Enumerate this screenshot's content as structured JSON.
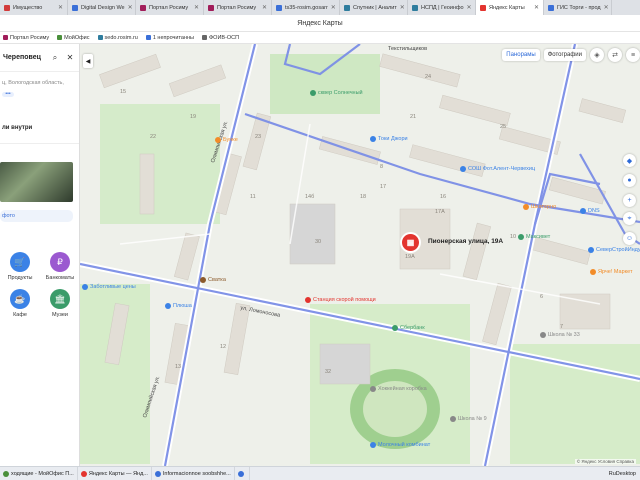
{
  "browser": {
    "tabs": [
      {
        "label": "Имущество",
        "color": "#d23b3b"
      },
      {
        "label": "Digital Design We",
        "color": "#3a6fd8"
      },
      {
        "label": "Портал Росиму",
        "color": "#a11d5a"
      },
      {
        "label": "Портал Росиму",
        "color": "#a11d5a"
      },
      {
        "label": "ts35-rosim.gosarr",
        "color": "#3a6fd8"
      },
      {
        "label": "Спутник | Аналит",
        "color": "#2f7d9e"
      },
      {
        "label": "НСПД | Геоинфо",
        "color": "#2f7d9e"
      },
      {
        "label": "Яндекс Карты",
        "color": "#e3342f"
      },
      {
        "label": "ГИС Торги - прод",
        "color": "#3a6fd8"
      }
    ],
    "window_title": "Яндекс Карты",
    "bookmarks": [
      {
        "label": "Портал Росиму",
        "color": "#a11d5a"
      },
      {
        "label": "МойОфис",
        "color": "#4a8f3a"
      },
      {
        "label": "sedo.rosim.ru",
        "color": "#2f7d9e"
      },
      {
        "label": "1 непрочитанны",
        "color": "#3a6fd8"
      },
      {
        "label": "ФОИВ-ОСП",
        "color": "#666666"
      }
    ]
  },
  "sidebar": {
    "search_value": "Череповец",
    "address": "ц, Вологодская область,",
    "more": "•••",
    "inside_label": "ли внутри",
    "photo_link": "фото",
    "categories": [
      {
        "label": "Продукты",
        "icon": "cart-icon",
        "color": "#3b82e6",
        "glyph": "🛒"
      },
      {
        "label": "Банкоматы",
        "icon": "ruble-icon",
        "color": "#9b59d0",
        "glyph": "₽"
      },
      {
        "label": "Кафе",
        "icon": "cup-icon",
        "color": "#3b82e6",
        "glyph": "☕"
      },
      {
        "label": "Музеи",
        "icon": "museum-icon",
        "color": "#3b9c6a",
        "glyph": "🏛"
      }
    ]
  },
  "map": {
    "buttons": {
      "panoramas": "Панорамы",
      "photos": "Фотографии"
    },
    "selected": {
      "label": "Пионерская улица, 19А"
    },
    "streets": [
      {
        "label": "Текстильщиков"
      },
      {
        "label": "Олимпийская ул."
      },
      {
        "label": "Пионерская ул."
      },
      {
        "label": "ул. Ломоносова"
      }
    ],
    "places": [
      {
        "label": "сквер Солнечный",
        "color": "#3b9c6a"
      },
      {
        "label": "Бунке",
        "color": "#f28c28"
      },
      {
        "label": "Токи Джори",
        "color": "#3b82e6"
      },
      {
        "label": "СОШ Фот.Алент-Червехиц",
        "color": "#3b82e6"
      },
      {
        "label": "Шкатерно",
        "color": "#f28c28"
      },
      {
        "label": "Максивет",
        "color": "#3b9c6a"
      },
      {
        "label": "DNS",
        "color": "#3b82e6"
      },
      {
        "label": "СеверСтройИндустрия",
        "color": "#3b82e6"
      },
      {
        "label": "Ярче! Маркет",
        "color": "#f28c28"
      },
      {
        "label": "Сватка",
        "color": "#8b5a2b"
      },
      {
        "label": "Станция скорой помощи",
        "color": "#e3342f"
      },
      {
        "label": "Сбербанк",
        "color": "#3b9c6a"
      },
      {
        "label": "Заботливые цены",
        "color": "#3b82e6"
      },
      {
        "label": "Плюша",
        "color": "#3b82e6"
      },
      {
        "label": "Школа № 33",
        "color": "#888888"
      },
      {
        "label": "Школа № 9",
        "color": "#888888"
      },
      {
        "label": "Молочный комбинат",
        "color": "#3b82e6"
      },
      {
        "label": "Хоккейная коробка",
        "color": "#888888"
      }
    ],
    "house_numbers": [
      "15",
      "19",
      "22",
      "23",
      "24",
      "21",
      "25",
      "16",
      "17",
      "18",
      "14б",
      "17А",
      "19А",
      "30",
      "32",
      "12",
      "13",
      "11",
      "10",
      "8",
      "6",
      "7"
    ],
    "copyright": "© Яндекс  Условия  Справка"
  },
  "taskbar": {
    "items": [
      {
        "label": "ходящие - МойОфис П...",
        "color": "#4a8f3a"
      },
      {
        "label": "Яндекс Карты — Янд...",
        "color": "#e3342f"
      },
      {
        "label": "Informacionnoe soobshhe...",
        "color": "#3a6fd8"
      },
      {
        "label": "",
        "color": "#3a6fd8"
      }
    ],
    "right_app": "RuDesktop"
  }
}
